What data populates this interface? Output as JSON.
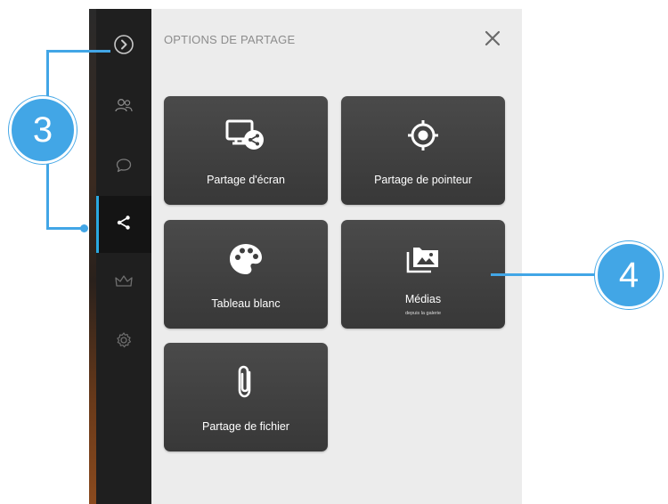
{
  "panel": {
    "title": "OPTIONS DE PARTAGE"
  },
  "rail": {
    "items": [
      {
        "name": "expand",
        "icon": "chevron-right-circle-icon"
      },
      {
        "name": "participants",
        "icon": "people-icon"
      },
      {
        "name": "chat",
        "icon": "chat-bubble-icon"
      },
      {
        "name": "share",
        "icon": "share-icon",
        "active": true
      },
      {
        "name": "crown",
        "icon": "crown-icon"
      },
      {
        "name": "settings",
        "icon": "gear-icon"
      }
    ]
  },
  "tiles": [
    {
      "label": "Partage d'écran",
      "icon": "screen-share-icon"
    },
    {
      "label": "Partage de pointeur",
      "icon": "target-icon"
    },
    {
      "label": "Tableau blanc",
      "icon": "palette-icon"
    },
    {
      "label": "Médias",
      "sublabel": "depuis la galerie",
      "icon": "gallery-icon"
    },
    {
      "label": "Partage de fichier",
      "icon": "paperclip-icon"
    }
  ],
  "callouts": {
    "left_number": "3",
    "right_number": "4"
  },
  "colors": {
    "accent": "#42a6e6",
    "rail_bg": "#1f1f1f",
    "panel_bg": "#ececec",
    "tile_bg": "#414141"
  }
}
